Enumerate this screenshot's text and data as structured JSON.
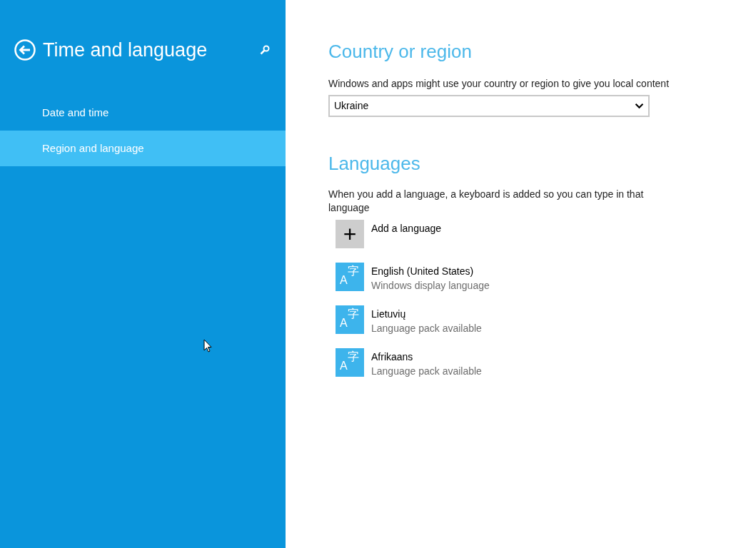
{
  "sidebar": {
    "title": "Time and language",
    "items": [
      {
        "label": "Date and time",
        "selected": false
      },
      {
        "label": "Region and language",
        "selected": true
      }
    ]
  },
  "country": {
    "heading": "Country or region",
    "description": "Windows and apps might use your country or region to give you local content",
    "value": "Ukraine"
  },
  "languages": {
    "heading": "Languages",
    "description": "When you add a language, a keyboard is added so you can type in that language",
    "add_label": "Add a language",
    "add_glyph": "+",
    "items": [
      {
        "name": "English (United States)",
        "status": "Windows display language",
        "icon_latin": "A",
        "icon_cjk": "字"
      },
      {
        "name": "Lietuvių",
        "status": "Language pack available",
        "icon_latin": "A",
        "icon_cjk": "字"
      },
      {
        "name": "Afrikaans",
        "status": "Language pack available",
        "icon_latin": "A",
        "icon_cjk": "字"
      }
    ]
  }
}
